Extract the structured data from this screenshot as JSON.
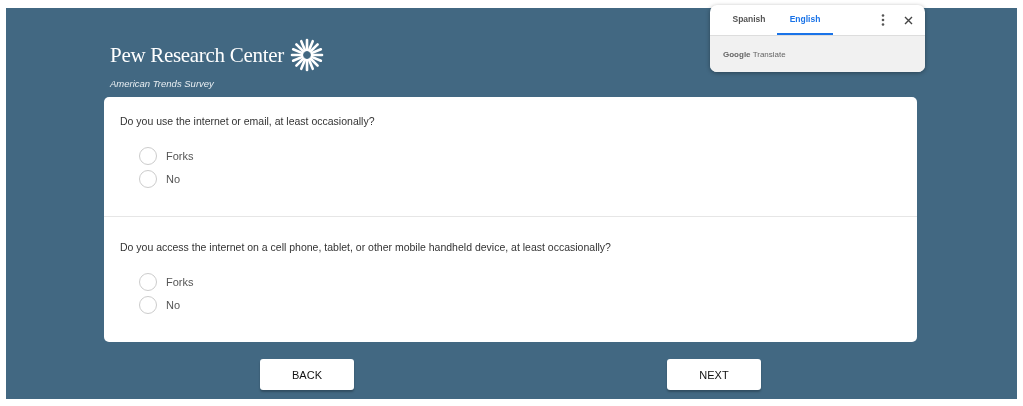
{
  "header": {
    "logo": "Pew Research Center",
    "subtitle": "American Trends Survey"
  },
  "questions": [
    {
      "text": "Do you use the internet or email, at least occasionally?",
      "options": [
        {
          "label": "Forks",
          "selected": false
        },
        {
          "label": "No",
          "selected": false
        }
      ]
    },
    {
      "text": "Do you access the internet on a cell phone, tablet, or other mobile handheld device, at least occasionally?",
      "options": [
        {
          "label": "Forks",
          "selected": false
        },
        {
          "label": "No",
          "selected": false
        }
      ]
    }
  ],
  "buttons": [
    "BACK",
    "NEXT"
  ],
  "translate_popup": {
    "tabs": [
      {
        "label": "Spanish",
        "selected": false
      },
      {
        "label": "English",
        "selected": true
      }
    ],
    "footer_brand": "Google",
    "footer_product": "Translate"
  }
}
